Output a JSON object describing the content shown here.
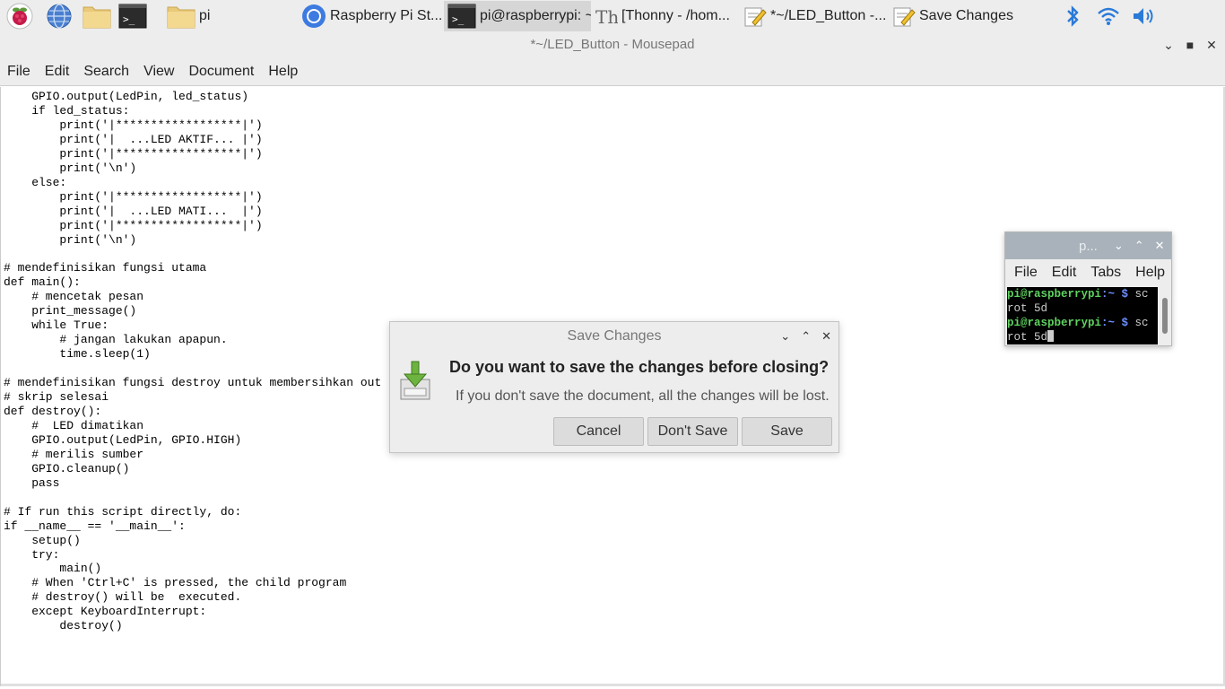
{
  "taskbar": {
    "tasks": [
      {
        "label": "pi",
        "icon": "folder-icon"
      },
      {
        "label": "Raspberry Pi St...",
        "icon": "chromium-icon"
      },
      {
        "label": "pi@raspberrypi: ~",
        "icon": "terminal-icon"
      },
      {
        "label": "[Thonny  -  /hom...",
        "icon": "thonny-icon"
      },
      {
        "label": "*~/LED_Button -...",
        "icon": "mousepad-icon"
      },
      {
        "label": "Save Changes",
        "icon": "mousepad-icon"
      }
    ]
  },
  "window": {
    "title": "*~/LED_Button - Mousepad",
    "menu": [
      "File",
      "Edit",
      "Search",
      "View",
      "Document",
      "Help"
    ]
  },
  "editor": {
    "lines": [
      "    GPIO.output(LedPin, led_status)",
      "    if led_status:",
      "        print('|******************|')",
      "        print('|  ...LED AKTIF... |')",
      "        print('|******************|')",
      "        print('\\n')",
      "    else:",
      "        print('|******************|')",
      "        print('|  ...LED MATI...  |')",
      "        print('|******************|')",
      "        print('\\n')",
      "",
      "# mendefinisikan fungsi utama",
      "def main():",
      "    # mencetak pesan",
      "    print_message()",
      "    while True:",
      "        # jangan lakukan apapun.",
      "        time.sleep(1)",
      "",
      "# mendefinisikan fungsi destroy untuk membersihkan out",
      "# skrip selesai",
      "def destroy():",
      "    #  LED dimatikan",
      "    GPIO.output(LedPin, GPIO.HIGH)",
      "    # merilis sumber",
      "    GPIO.cleanup()",
      "    pass",
      "",
      "# If run this script directly, do:",
      "if __name__ == '__main__':",
      "    setup()",
      "    try:",
      "        main()",
      "    # When 'Ctrl+C' is pressed, the child program",
      "    # destroy() will be  executed.",
      "    except KeyboardInterrupt:",
      "        destroy()"
    ]
  },
  "terminal": {
    "title": "p...",
    "menu": [
      "File",
      "Edit",
      "Tabs",
      "Help"
    ],
    "lines": [
      {
        "prompt_user": "pi@raspberrypi",
        "prompt_path": ":~ $",
        "cmd": " sc"
      },
      {
        "text": "rot 5d"
      },
      {
        "prompt_user": "pi@raspberrypi",
        "prompt_path": ":~ $",
        "cmd": " sc"
      },
      {
        "text": "rot 5d"
      }
    ]
  },
  "dialog": {
    "title": "Save Changes",
    "heading": "Do you want to save the changes before closing?",
    "message": "If you don't save the document, all the changes will be lost.",
    "buttons": {
      "cancel": "Cancel",
      "dont_save": "Don't Save",
      "save": "Save"
    }
  }
}
